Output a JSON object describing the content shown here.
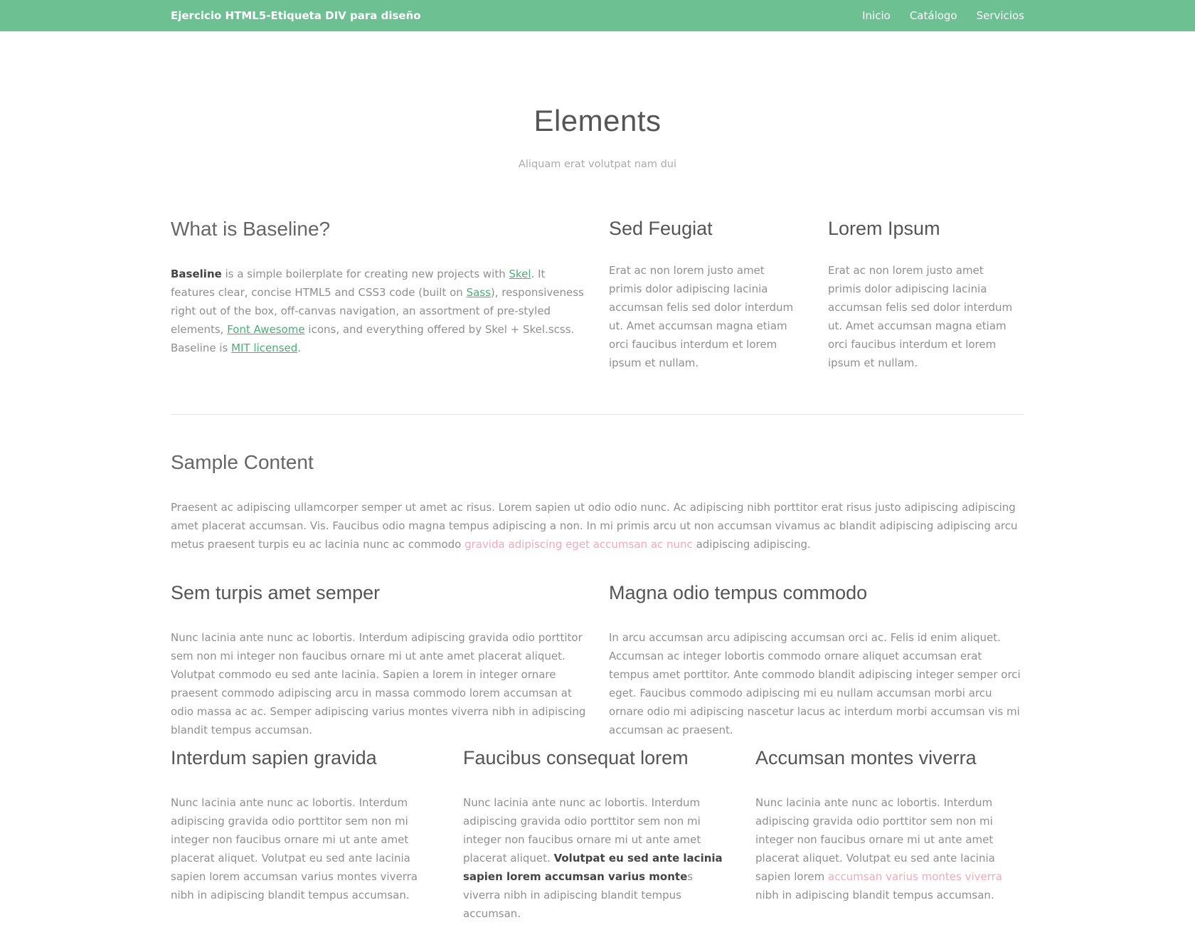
{
  "header": {
    "brand": "Ejercicio HTML5-Etiqueta DIV para diseño",
    "nav": [
      {
        "label": "Inicio"
      },
      {
        "label": "Catálogo"
      },
      {
        "label": "Servicios"
      }
    ]
  },
  "page": {
    "title": "Elements",
    "subtitle": "Aliquam erat volutpat nam dui"
  },
  "baseline": {
    "heading": "What is Baseline?",
    "strong": "Baseline",
    "t1": " is a simple boilerplate for creating new projects with ",
    "link_skel": "Skel",
    "t2": ". It features clear, concise HTML5 and CSS3 code (built on ",
    "link_sass": "Sass",
    "t3": "), responsiveness right out of the box, off-canvas navigation, an assortment of pre-styled elements, ",
    "link_fa": "Font Awesome",
    "t4": " icons, and everything offered by Skel + Skel.scss. Baseline is ",
    "link_mit": "MIT licensed",
    "t5": "."
  },
  "sed_feugiat": {
    "heading": "Sed Feugiat",
    "body": "Erat ac non lorem justo amet primis dolor adipiscing lacinia accumsan felis sed dolor interdum ut. Amet accumsan magna etiam orci faucibus interdum et lorem ipsum et nullam."
  },
  "lorem_ipsum": {
    "heading": "Lorem Ipsum",
    "body": "Erat ac non lorem justo amet primis dolor adipiscing lacinia accumsan felis sed dolor interdum ut. Amet accumsan magna etiam orci faucibus interdum et lorem ipsum et nullam."
  },
  "sample": {
    "heading": "Sample Content",
    "t1": "Praesent ac adipiscing ullamcorper semper ut amet ac risus. Lorem sapien ut odio odio nunc. Ac adipiscing nibh porttitor erat risus justo adipiscing adipiscing amet placerat accumsan. Vis. Faucibus odio magna tempus adipiscing a non. In mi primis arcu ut non accumsan vivamus ac blandit adipiscing adipiscing arcu metus praesent turpis eu ac lacinia nunc ac commodo ",
    "pink": "gravida adipiscing eget accumsan ac nunc",
    "t2": " adipiscing adipiscing."
  },
  "sem_turpis": {
    "heading": "Sem turpis amet semper",
    "body": "Nunc lacinia ante nunc ac lobortis. Interdum adipiscing gravida odio porttitor sem non mi integer non faucibus ornare mi ut ante amet placerat aliquet. Volutpat commodo eu sed ante lacinia. Sapien a lorem in integer ornare praesent commodo adipiscing arcu in massa commodo lorem accumsan at odio massa ac ac. Semper adipiscing varius montes viverra nibh in adipiscing blandit tempus accumsan."
  },
  "magna_odio": {
    "heading": "Magna odio tempus commodo",
    "body": "In arcu accumsan arcu adipiscing accumsan orci ac. Felis id enim aliquet. Accumsan ac integer lobortis commodo ornare aliquet accumsan erat tempus amet porttitor. Ante commodo blandit adipiscing integer semper orci eget. Faucibus commodo adipiscing mi eu nullam accumsan morbi arcu ornare odio mi adipiscing nascetur lacus ac interdum morbi accumsan vis mi accumsan ac praesent."
  },
  "interdum": {
    "heading": "Interdum sapien gravida",
    "body": "Nunc lacinia ante nunc ac lobortis. Interdum adipiscing gravida odio porttitor sem non mi integer non faucibus ornare mi ut ante amet placerat aliquet. Volutpat eu sed ante lacinia sapien lorem accumsan varius montes viverra nibh in adipiscing blandit tempus accumsan."
  },
  "faucibus": {
    "heading": "Faucibus consequat lorem",
    "t1": "Nunc lacinia ante nunc ac lobortis. Interdum adipiscing gravida odio porttitor sem non mi integer non faucibus ornare mi ut ante amet placerat aliquet. ",
    "bold": "Volutpat eu sed ante lacinia sapien lorem accumsan varius monte",
    "t2": "s viverra nibh in adipiscing blandit tempus accumsan."
  },
  "accumsan": {
    "heading": "Accumsan montes viverra",
    "t1": "Nunc lacinia ante nunc ac lobortis. Interdum adipiscing gravida odio porttitor sem non mi integer non faucibus ornare mi ut ante amet placerat aliquet. Volutpat eu sed ante lacinia sapien lorem ",
    "pink": "accumsan varius montes viverra",
    "t2": " nibh in adipiscing blandit tempus accumsan."
  }
}
